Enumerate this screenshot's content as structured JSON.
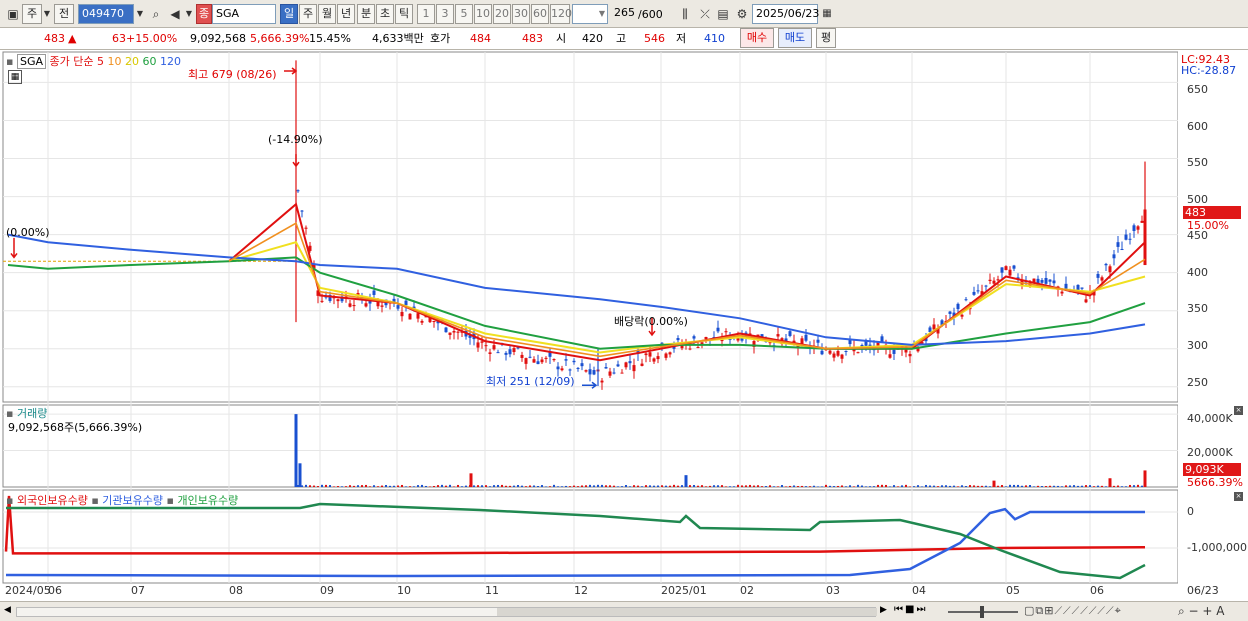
{
  "toolbar": {
    "b_ju": "주",
    "b_jeon": "전",
    "code": "049470",
    "mode_icon": "종",
    "name": "SGA",
    "periods": [
      "일",
      "주",
      "월",
      "년",
      "분",
      "초",
      "틱"
    ],
    "ticks": [
      "1",
      "3",
      "5",
      "10",
      "20",
      "30",
      "60",
      "120"
    ],
    "count": "265",
    "count_max": "/600",
    "date": "2025/06/23"
  },
  "quote": {
    "price": "483",
    "arrow": "▲",
    "change": "63",
    "pct": "+15.00%",
    "volume": "9,092,568",
    "vol_ratio": "5,666.39%",
    "turnover": "15.45%",
    "amount": "4,633백만",
    "hoga_label": "호가",
    "hoga_sell": "484",
    "hoga_buy": "483",
    "open_label": "시",
    "open": "420",
    "high_label": "고",
    "high": "546",
    "low_label": "저",
    "low": "410",
    "buy_btn": "매수",
    "sell_btn": "매도",
    "avg_btn": "평"
  },
  "price_panel": {
    "symbol": "SGA",
    "ma_label": "종가 단순",
    "ma_periods": [
      "5",
      "10",
      "20",
      "60",
      "120"
    ],
    "ma_colors": [
      "#e01010",
      "#f09020",
      "#f0e020",
      "#20a040",
      "#3060e0"
    ],
    "max_note": "최고 679 (08/26)",
    "min_note": "최저 251 (12/09)",
    "pct_note1": "(-14.90%)",
    "pct_note2": "(0.00%)",
    "div_note": "배당락(0.00%)",
    "lc": "LC:92.43",
    "hc": "HC:-28.87",
    "yaxis": [
      "650",
      "600",
      "550",
      "500",
      "450",
      "400",
      "350",
      "300",
      "250"
    ],
    "price_tag": "483",
    "pct_tag": "15.00%"
  },
  "volume_panel": {
    "title": "거래량",
    "value": "9,092,568주(5,666.39%)",
    "yaxis": [
      "40,000K",
      "20,000K"
    ],
    "tag1": "9,093K",
    "tag2": "5666.39%"
  },
  "holding_panel": {
    "legend": [
      "외국인보유수량",
      "기관보유수량",
      "개인보유수량"
    ],
    "legend_colors": [
      "#e01010",
      "#3060e0",
      "#20a040"
    ],
    "yaxis": [
      "0",
      "-1,000,000"
    ]
  },
  "xaxis": [
    "2024/05",
    "06",
    "07",
    "08",
    "09",
    "10",
    "11",
    "12",
    "2025/01",
    "02",
    "03",
    "04",
    "05",
    "06",
    "06/23"
  ],
  "chart_data": {
    "type": "candlestick",
    "x": [
      "2024/05",
      "2024/06",
      "2024/07",
      "2024/08",
      "2024/08/26",
      "2024/09",
      "2024/10",
      "2024/11",
      "2024/12/09",
      "2025/01",
      "2025/02",
      "2025/03",
      "2025/04",
      "2025/05",
      "2025/06",
      "2025/06/23"
    ],
    "close": [
      415,
      415,
      415,
      415,
      520,
      370,
      360,
      305,
      265,
      300,
      320,
      300,
      300,
      400,
      370,
      483
    ],
    "ma5": [
      null,
      null,
      null,
      415,
      490,
      370,
      360,
      310,
      285,
      300,
      320,
      300,
      300,
      395,
      370,
      440
    ],
    "ma20": [
      null,
      null,
      null,
      415,
      440,
      380,
      360,
      320,
      295,
      305,
      315,
      300,
      305,
      385,
      375,
      395
    ],
    "ma60": [
      410,
      405,
      410,
      415,
      420,
      400,
      370,
      330,
      300,
      305,
      305,
      300,
      300,
      320,
      335,
      360
    ],
    "ma120": [
      450,
      440,
      430,
      420,
      415,
      410,
      405,
      380,
      365,
      355,
      340,
      315,
      305,
      310,
      320,
      332
    ],
    "high_max": 679,
    "low_min": 251,
    "ylim": [
      230,
      690
    ],
    "volume_K": [
      null,
      null,
      null,
      null,
      40000,
      2500,
      1500,
      1500,
      1200,
      6500,
      800,
      600,
      800,
      3500,
      2000,
      9093
    ],
    "ylim_volume_K": [
      0,
      45000
    ]
  }
}
